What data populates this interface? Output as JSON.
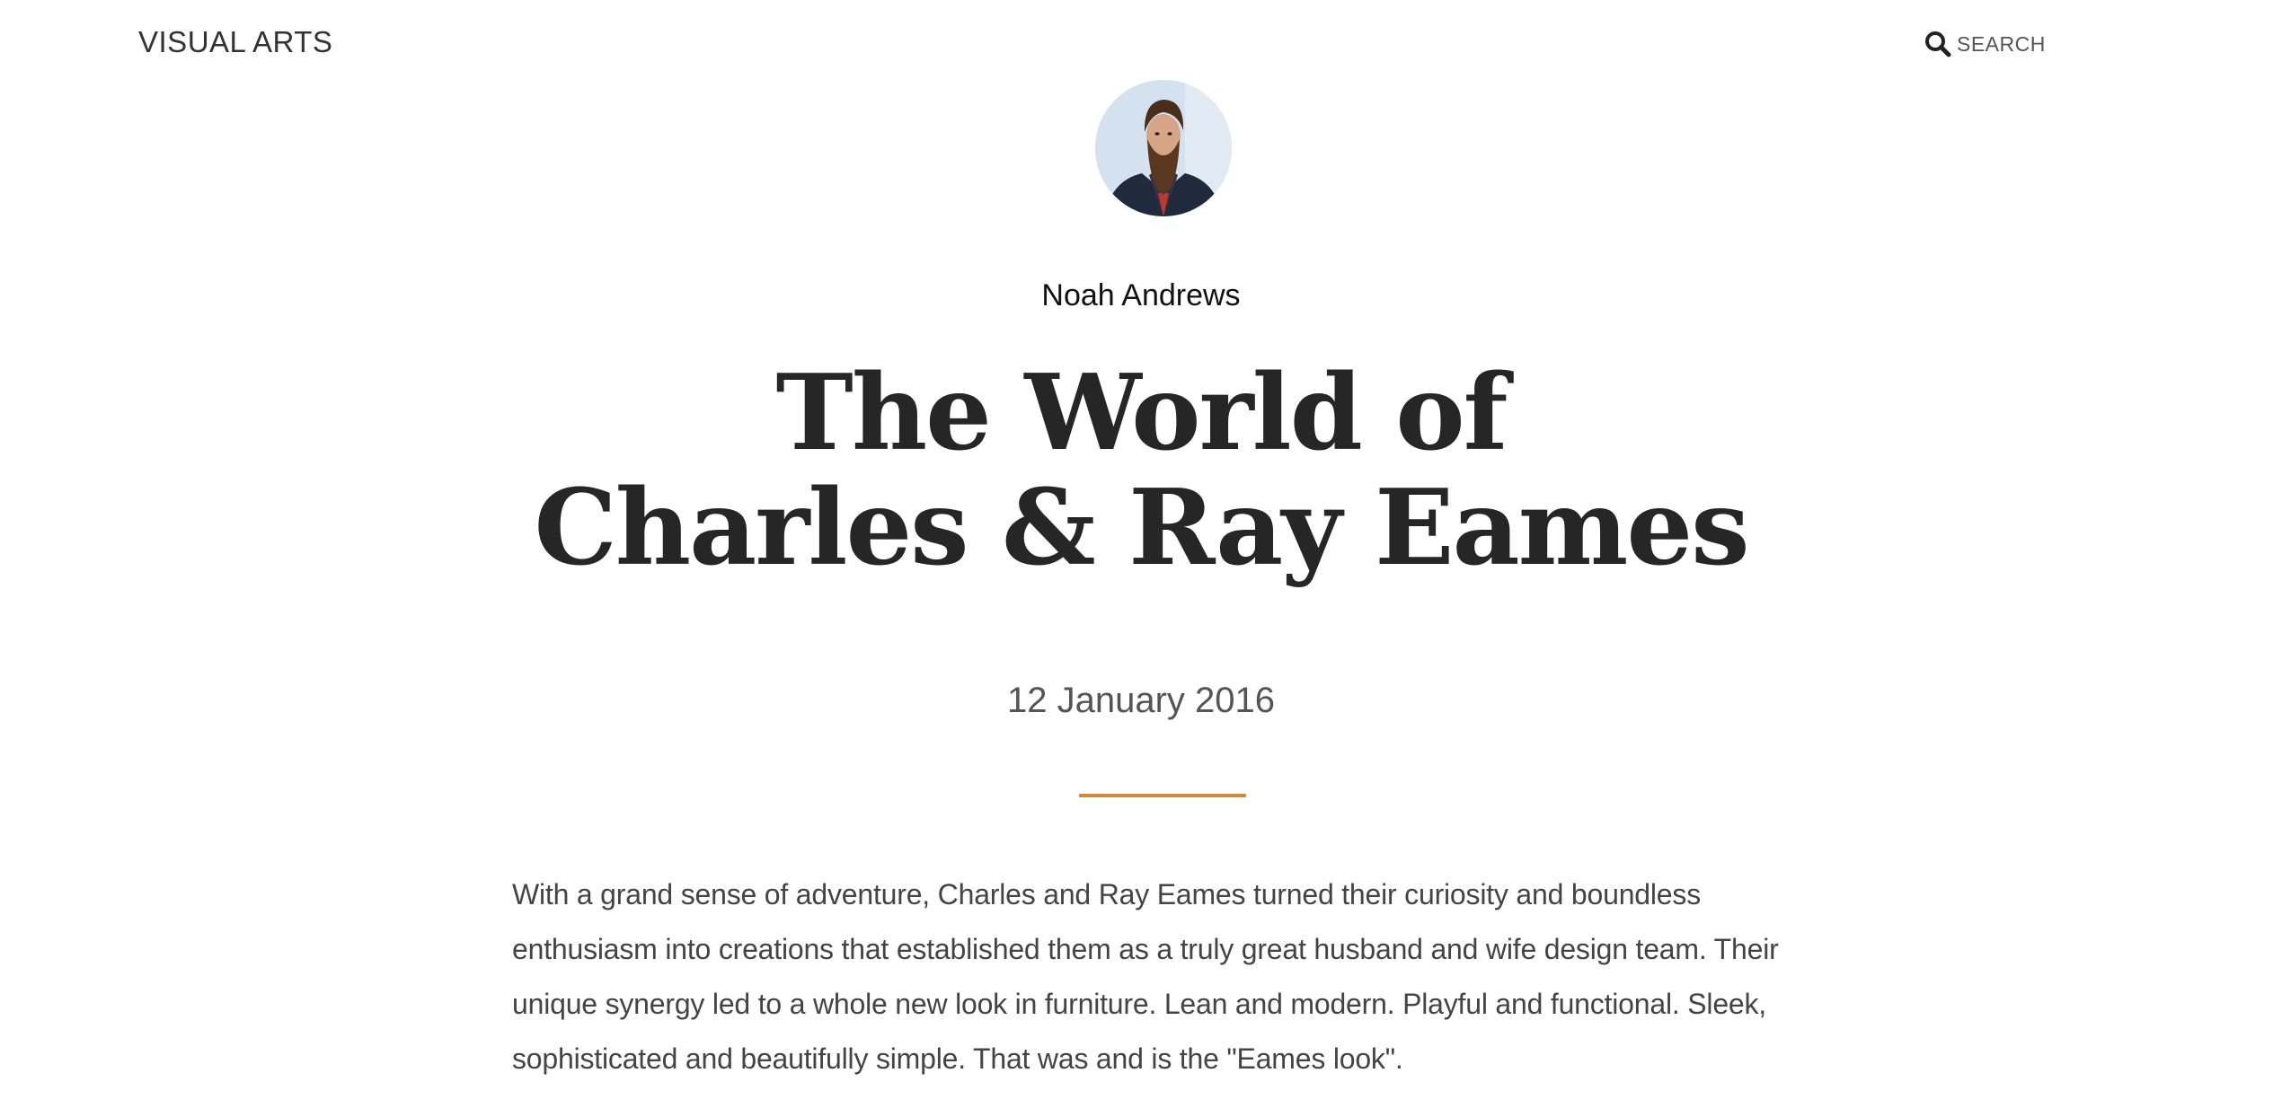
{
  "header": {
    "brand": "VISUAL ARTS",
    "search_label": "SEARCH",
    "search_icon": "search-icon"
  },
  "article": {
    "author_avatar": "bearded man portrait",
    "author_name": "Noah Andrews",
    "title_line1": "The World of",
    "title_line2": "Charles & Ray Eames",
    "date": "12 January 2016",
    "divider_color": "#d08b3a",
    "body": "With a grand sense of adventure, Charles and Ray Eames turned their curiosity and boundless enthusiasm into creations that established them as a truly great husband and wife design team. Their unique synergy led to a whole new look in furniture. Lean and modern. Playful and functional. Sleek, sophisticated and beautifully simple. That was and is the \"Eames look\"."
  }
}
